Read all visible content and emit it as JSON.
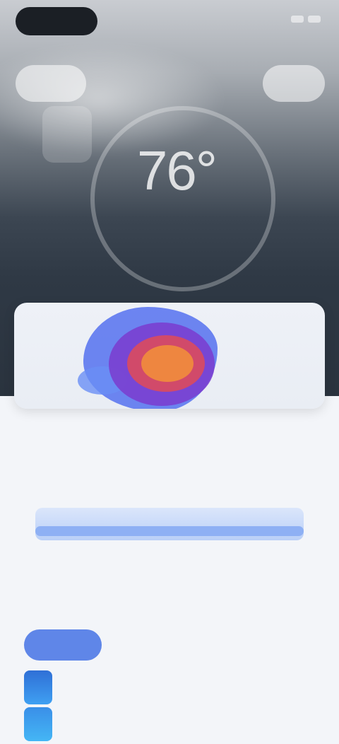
{
  "hero": {
    "temperature": "76°",
    "condition": "",
    "high_low": "",
    "left_button": "",
    "right_button": ""
  },
  "sections": {
    "chart_title": "",
    "list_title": ""
  },
  "chart_axis": [
    "",
    "",
    "",
    "",
    ""
  ],
  "tabs": [
    "",
    "",
    "",
    ""
  ],
  "rows": [
    {
      "name": "",
      "value": ""
    },
    {
      "name": "",
      "value": ""
    }
  ],
  "colors": {
    "accent": "#5f86e8",
    "radar_outer": "#5d78f0",
    "radar_mid": "#7a3fd0",
    "radar_core": "#ee8640"
  },
  "icons": [
    "status-bar-pill",
    "signal-icon",
    "battery-icon",
    "weather-glyph-icon"
  ]
}
